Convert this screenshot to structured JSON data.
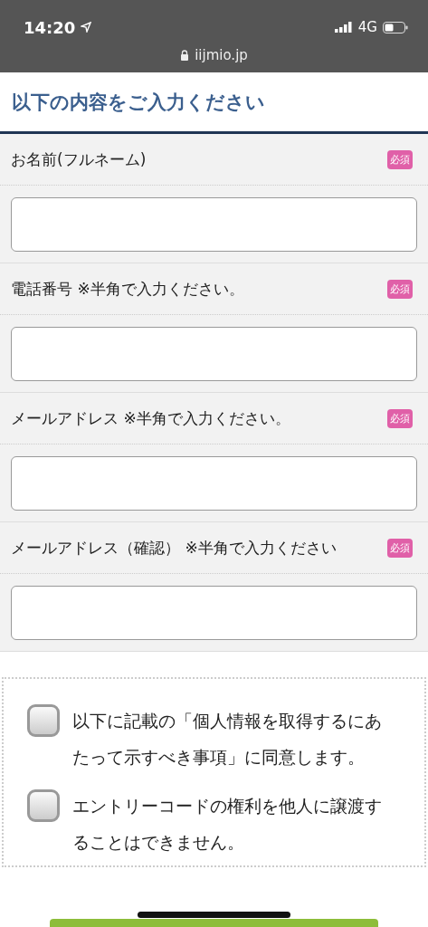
{
  "status_bar": {
    "time": "14:20",
    "network": "4G"
  },
  "address_bar": {
    "url": "iijmio.jp"
  },
  "heading": "以下の内容をご入力ください",
  "fields": [
    {
      "label": "お名前(フルネーム)",
      "badge": "必須"
    },
    {
      "label": "電話番号 ※半角で入力ください。",
      "badge": "必須"
    },
    {
      "label": "メールアドレス ※半角で入力ください。",
      "badge": "必須"
    },
    {
      "label": "メールアドレス（確認） ※半角で入力ください",
      "badge": "必須"
    }
  ],
  "agreements": [
    {
      "text": "以下に記載の「個人情報を取得するにあたって示すべき事項」に同意します。",
      "checked": false
    },
    {
      "text": "エントリーコードの権利を他人に譲渡することはできません。",
      "checked": false
    }
  ]
}
